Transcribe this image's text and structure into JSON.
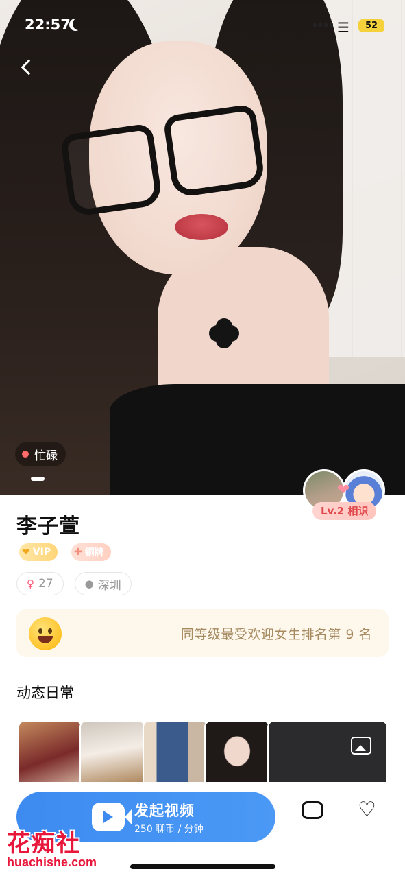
{
  "status_bar": {
    "time": "22:57",
    "battery": "52",
    "wifi_icon": "wifi-icon",
    "moon_icon": "moon-icon"
  },
  "photo": {
    "status_label": "忙碌",
    "status_color": "#ff6b6b",
    "page_index": 1
  },
  "intimacy": {
    "level_label": "Lv.2 相识"
  },
  "profile": {
    "name": "李子萱",
    "badges": [
      {
        "icon": "heart-crown-icon",
        "label": "VIP"
      },
      {
        "icon": "bronze-medal-icon",
        "label": "铜牌"
      }
    ],
    "age": "27",
    "city": "深圳",
    "rank_text": "同等级最受欢迎女生排名第 9 名"
  },
  "moments": {
    "title": "动态日常",
    "photo_count": 5
  },
  "actions": {
    "call_label": "发起视频",
    "call_price": "250 聊币 / 分钟",
    "chat_icon": "chat-bubble-icon",
    "favorite_icon": "heart-icon"
  },
  "watermark": {
    "title": "花痴社",
    "url": "huachishe.com"
  },
  "colors": {
    "primary_blue": "#3d8bf0",
    "level_red": "#e0484b",
    "rank_text": "#a68a60"
  }
}
